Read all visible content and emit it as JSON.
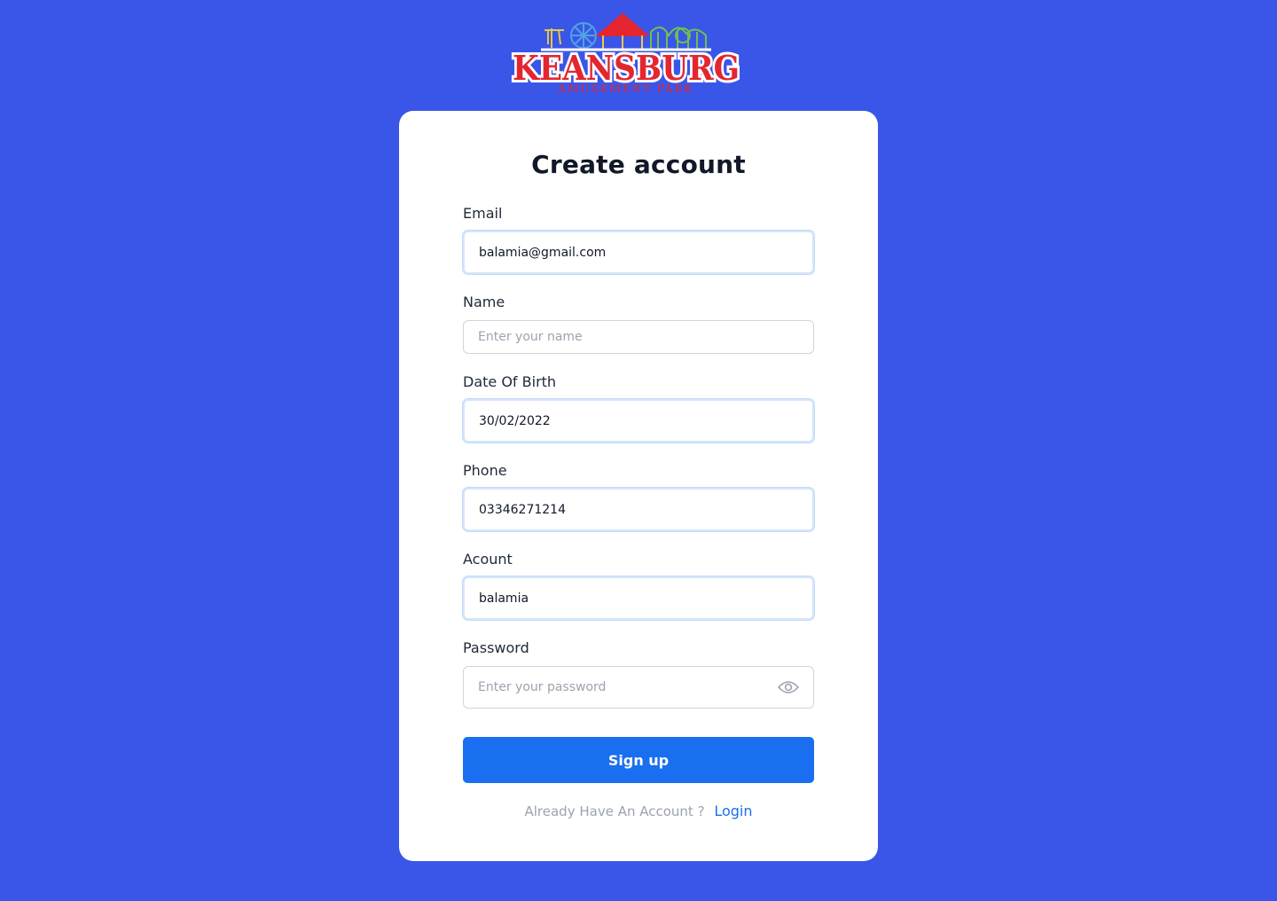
{
  "brand": {
    "logo_name": "KEANSBURG",
    "logo_sub": "AMUSEMENT PARK",
    "colors": {
      "background": "#3a56e8",
      "primary": "#1a6ff0",
      "logo_red": "#e3262f"
    }
  },
  "form": {
    "title": "Create account",
    "fields": {
      "email": {
        "label": "Email",
        "value": "balamia@gmail.com"
      },
      "name": {
        "label": "Name",
        "placeholder": "Enter your name"
      },
      "dob": {
        "label": "Date Of Birth",
        "value": "30/02/2022"
      },
      "phone": {
        "label": "Phone",
        "value": "03346271214"
      },
      "account": {
        "label": "Acount",
        "value": "balamia"
      },
      "password": {
        "label": "Password",
        "placeholder": "Enter your password",
        "icon": "eye-icon"
      }
    },
    "submit_label": "Sign up",
    "footer_text": "Already Have An Account ?",
    "login_link": "Login"
  }
}
